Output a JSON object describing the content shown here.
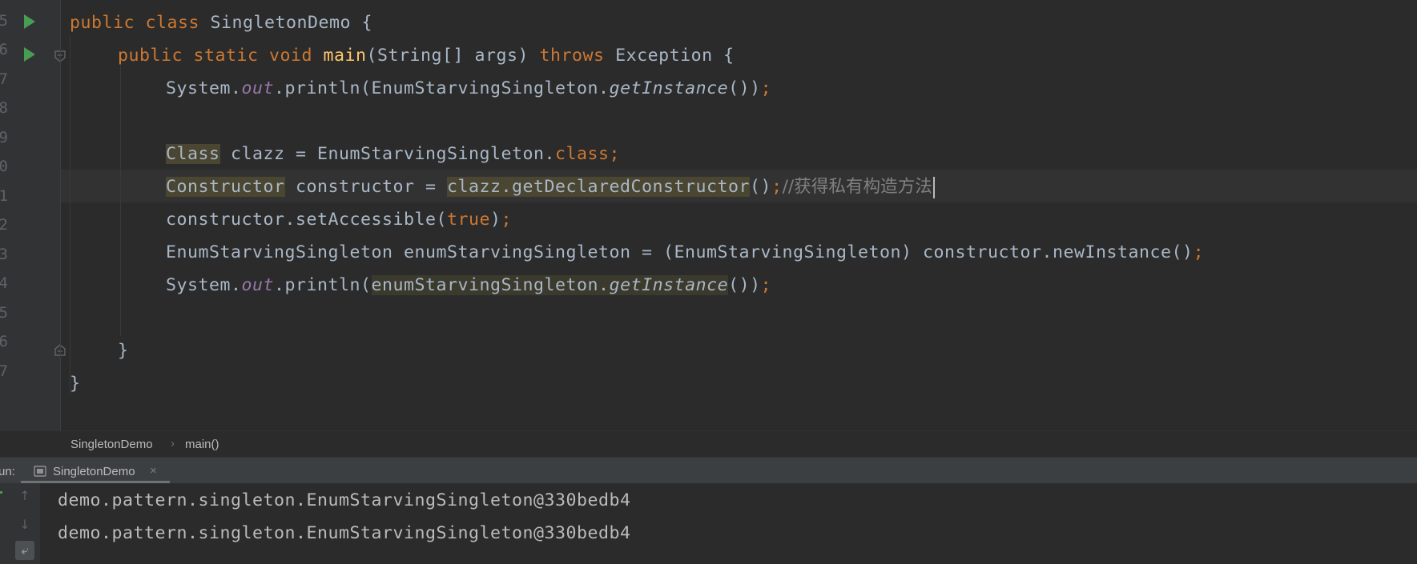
{
  "editor": {
    "line_numbers": [
      "5",
      "6",
      "7",
      "8",
      "9",
      "0",
      "1",
      "2",
      "3",
      "4",
      "5",
      "6",
      "7"
    ],
    "lines": {
      "l5": {
        "a": "public class ",
        "b": "SingletonDemo {"
      },
      "l6": {
        "a": "public static void ",
        "b": "main",
        "c": "(String[] args) ",
        "d": "throws ",
        "e": "Exception {"
      },
      "l7": {
        "a": "System.",
        "b": "out",
        "c": ".println(EnumStarvingSingleton.",
        "d": "getInstance",
        "e": "())",
        "f": ";"
      },
      "l9": {
        "a": "Class",
        "b": " clazz = EnumStarvingSingleton.",
        "c": "class;"
      },
      "l10": {
        "a": "Constructor",
        "b": " constructor = ",
        "c": "clazz.getDeclaredConstructor",
        "d": "()",
        "e": ";",
        "f": "//获得私有构造方法"
      },
      "l11": {
        "a": "constructor.setAccessible(",
        "b": "true",
        "c": ")",
        "d": ";"
      },
      "l12": {
        "a": "EnumStarvingSingleton enumStarvingSingleton = (EnumStarvingSingleton) constructor.newInstance()",
        "b": ";"
      },
      "l13": {
        "a": "System.",
        "b": "out",
        "c": ".println(",
        "d": "enumStarvingSingleton.",
        "e": "getInstance",
        "f": "())",
        "g": ";"
      },
      "l15": {
        "a": "}"
      },
      "l16": {
        "a": "}"
      }
    }
  },
  "breadcrumb": {
    "class_name": "SingletonDemo",
    "separator": "›",
    "method_name": "main()"
  },
  "run_panel": {
    "label": "un:",
    "tab_label": "SingletonDemo",
    "close_glyph": "×",
    "right_glyph": "⋮"
  },
  "console": {
    "output": [
      "demo.pattern.singleton.EnumStarvingSingleton@330bedb4",
      "demo.pattern.singleton.EnumStarvingSingleton@330bedb4"
    ],
    "tools": {
      "up": "↑",
      "down": "↓",
      "wrap": "⤶"
    }
  },
  "colors": {
    "keyword": "#cc7832",
    "method_decl": "#ffc66d",
    "static_field": "#9876aa",
    "comment": "#808080",
    "default_text": "#a9b7c6",
    "background": "#2b2b2b",
    "run_icon": "#499c54"
  },
  "icons": [
    "run-icon",
    "fold-icon",
    "class-icon",
    "close-icon",
    "arrow-up-icon",
    "arrow-down-icon",
    "soft-wrap-icon"
  ]
}
